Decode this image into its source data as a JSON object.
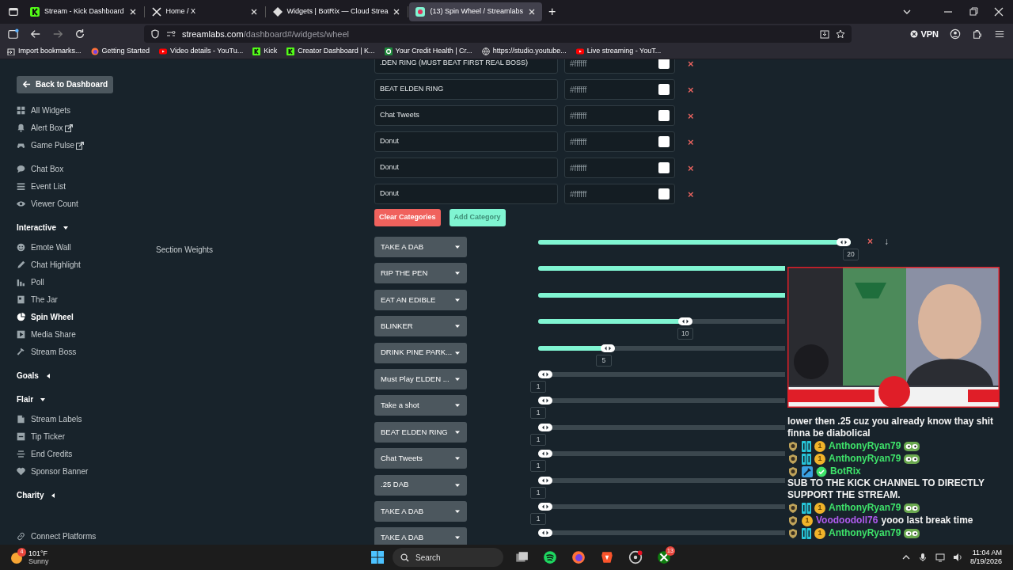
{
  "browser": {
    "tabs": [
      {
        "title": "Stream - Kick Dashboard",
        "selected": false
      },
      {
        "title": "Home / X",
        "selected": false
      },
      {
        "title": "Widgets | BotRix — Cloud Strea",
        "selected": false
      },
      {
        "title": "(13) Spin Wheel / Streamlabs",
        "selected": true
      }
    ],
    "new_tab": "+",
    "url_host": "streamlabs.com",
    "url_path": "/dashboard#/widgets/wheel",
    "vpn": "VPN",
    "bookmarks": [
      "Import bookmarks...",
      "Getting Started",
      "Video details - YouTu...",
      "Kick",
      "Creator Dashboard | K...",
      "Your Credit Health | Cr...",
      "https://studio.youtube...",
      "Live streaming - YouT..."
    ]
  },
  "sidebar": {
    "back": "Back to Dashboard",
    "sections": [
      {
        "items": [
          {
            "label": "All Widgets",
            "external": false,
            "selected": false
          },
          {
            "label": "Alert Box",
            "external": true,
            "selected": false
          },
          {
            "label": "Game Pulse",
            "external": true,
            "selected": false
          }
        ]
      },
      {
        "items": [
          {
            "label": "Chat Box",
            "external": false,
            "selected": false
          },
          {
            "label": "Event List",
            "external": false,
            "selected": false
          },
          {
            "label": "Viewer Count",
            "external": false,
            "selected": false
          }
        ]
      },
      {
        "header": "Interactive",
        "expanded": true,
        "items": [
          {
            "label": "Emote Wall",
            "external": false,
            "selected": false
          },
          {
            "label": "Chat Highlight",
            "external": false,
            "selected": false
          },
          {
            "label": "Poll",
            "external": false,
            "selected": false
          },
          {
            "label": "The Jar",
            "external": false,
            "selected": false
          },
          {
            "label": "Spin Wheel",
            "external": false,
            "selected": true
          },
          {
            "label": "Media Share",
            "external": false,
            "selected": false
          },
          {
            "label": "Stream Boss",
            "external": false,
            "selected": false
          }
        ]
      },
      {
        "header": "Goals",
        "expanded": false
      },
      {
        "header": "Flair",
        "expanded": true,
        "items": [
          {
            "label": "Stream Labels",
            "external": false,
            "selected": false
          },
          {
            "label": "Tip Ticker",
            "external": false,
            "selected": false
          },
          {
            "label": "End Credits",
            "external": false,
            "selected": false
          },
          {
            "label": "Sponsor Banner",
            "external": false,
            "selected": false
          }
        ]
      },
      {
        "header": "Charity",
        "expanded": false
      }
    ],
    "footer": "Connect Platforms"
  },
  "categories": [
    {
      "name": ".DEN RING (MUST BEAT FIRST REAL BOSS)",
      "color_value": "#ffffff",
      "remove": "×"
    },
    {
      "name": "BEAT ELDEN RING",
      "color_value": "#ffffff",
      "remove": "×"
    },
    {
      "name": "Chat Tweets",
      "color_value": "#ffffff",
      "remove": "×"
    },
    {
      "name": "Donut",
      "color_value": "#ffffff",
      "remove": "×"
    },
    {
      "name": "Donut",
      "color_value": "#ffffff",
      "remove": "×"
    },
    {
      "name": "Donut",
      "color_value": "#ffffff",
      "remove": "×"
    }
  ],
  "clear_button": "Clear Categories",
  "add_button": "Add Category",
  "section_weights": {
    "label": "Section Weights",
    "rows": [
      {
        "option": "TAKE A DAB",
        "level": 1,
        "reading": "20",
        "controls": [
          "×",
          "↓"
        ]
      },
      {
        "option": "RIP THE PEN",
        "level": 1
      },
      {
        "option": "EAT AN EDIBLE",
        "level": 1
      },
      {
        "option": "BLINKER",
        "level": 0.47,
        "reading": "10"
      },
      {
        "option": "DRINK PINE PARK...",
        "level": 0.21,
        "reading": "5"
      },
      {
        "option": "Must Play ELDEN ...",
        "level": 0,
        "reading": "1"
      },
      {
        "option": "Take a shot",
        "level": 0,
        "reading": "1"
      },
      {
        "option": "BEAT ELDEN RING",
        "level": 0,
        "reading": "1"
      },
      {
        "option": "Chat Tweets",
        "level": 0,
        "reading": "1"
      },
      {
        "option": ".25 DAB",
        "level": 0,
        "reading": "1"
      },
      {
        "option": "TAKE A DAB",
        "level": 0,
        "reading": "1"
      },
      {
        "option": "TAKE A DAB",
        "level": 0
      }
    ]
  },
  "stream_overlay": {
    "chat": [
      {
        "kind": "text",
        "text": "lower then .25 cuz you already know thay shit finna be diabolical"
      },
      {
        "kind": "message",
        "user": "AnthonyRyan79",
        "color": "#3ee36a",
        "tier": "1",
        "emote": true
      },
      {
        "kind": "message",
        "user": "AnthonyRyan79",
        "color": "#3ee36a",
        "tier": "1",
        "emote": true
      },
      {
        "kind": "message",
        "user": "BotRix",
        "color": "#3ee36a",
        "verified": true,
        "text": "SUB TO THE KICK CHANNEL TO DIRECTLY SUPPORT THE STREAM."
      },
      {
        "kind": "message",
        "user": "AnthonyRyan79",
        "color": "#3ee36a",
        "tier": "1",
        "emote": true
      },
      {
        "kind": "message",
        "user": "Voodoodoll76",
        "color": "#b15cf0",
        "tier": "1",
        "text": "yooo last break time"
      },
      {
        "kind": "message",
        "user": "AnthonyRyan79",
        "color": "#3ee36a",
        "tier": "1",
        "emote": true
      }
    ]
  },
  "taskbar": {
    "weather": {
      "alert": "4",
      "temp": "101°F",
      "condition": "Sunny"
    },
    "search": "Search",
    "app_badge": "13",
    "time": "11:04 AM",
    "date": "8/19/2026"
  }
}
